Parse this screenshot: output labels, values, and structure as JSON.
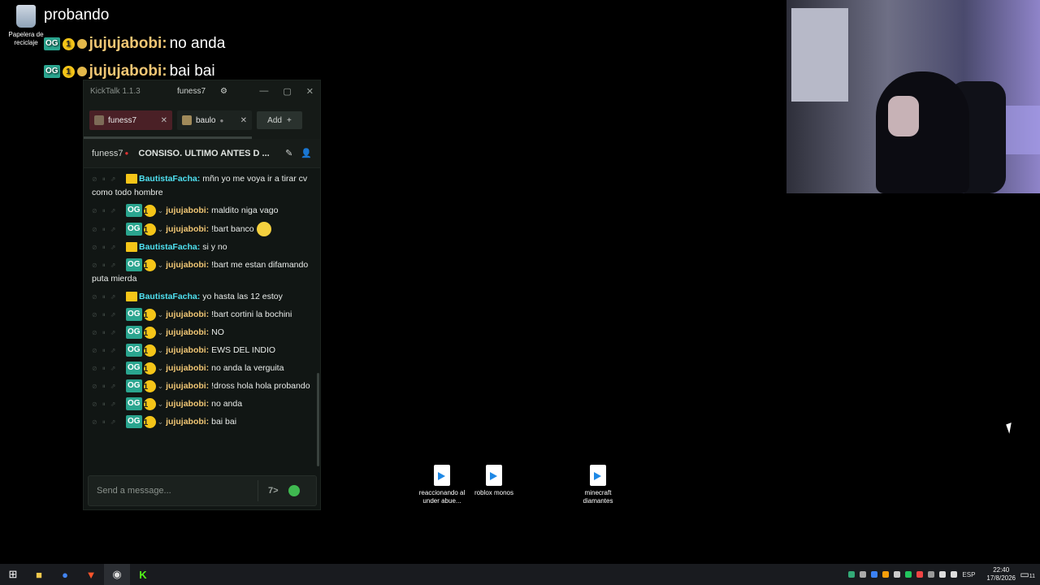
{
  "desktop": {
    "recycle_bin": "Papelera de reciclaje",
    "icons": [
      {
        "label": "reaccionando al under abue..."
      },
      {
        "label": "roblox monos"
      },
      {
        "label": "minecraft diamantes"
      }
    ]
  },
  "overlay": {
    "lines": [
      {
        "user": "",
        "text": "probando"
      },
      {
        "user": "jujujabobi:",
        "text": "no anda"
      },
      {
        "user": "jujujabobi:",
        "text": "bai bai"
      }
    ],
    "badge_og": "OG",
    "badge_sub": "1"
  },
  "window": {
    "app_title": "KickTalk 1.1.3",
    "center_user": "funess7",
    "settings_icon": "gear-icon",
    "controls": [
      "—",
      "▢",
      "✕"
    ]
  },
  "tabs": [
    {
      "label": "funess7",
      "active": true
    },
    {
      "label": "baulo",
      "active": false
    }
  ],
  "add_label": "Add",
  "channel": {
    "name": "funess7",
    "title": "CONSISO. ULTIMO ANTES D ..."
  },
  "messages": [
    {
      "user": "BautistaFacha:",
      "text": "mñn yo me voya ir a tirar cv como todo hombre",
      "color": "cyan",
      "badges": "crown"
    },
    {
      "user": "jujujabobi:",
      "text": "maldito niga vago",
      "color": "yellow",
      "badges": "og"
    },
    {
      "user": "jujujabobi:",
      "text": "!bart banco",
      "color": "yellow",
      "badges": "og",
      "emote": true
    },
    {
      "user": "BautistaFacha:",
      "text": "si y no",
      "color": "cyan",
      "badges": "crown"
    },
    {
      "user": "jujujabobi:",
      "text": "!bart me estan difamando puta mierda",
      "color": "yellow",
      "badges": "og"
    },
    {
      "user": "BautistaFacha:",
      "text": "yo hasta las 12 estoy",
      "color": "cyan",
      "badges": "crown"
    },
    {
      "user": "jujujabobi:",
      "text": "!bart cortini la bochini",
      "color": "yellow",
      "badges": "og"
    },
    {
      "user": "jujujabobi:",
      "text": "NO",
      "color": "yellow",
      "badges": "og"
    },
    {
      "user": "jujujabobi:",
      "text": "EWS DEL INDIO",
      "color": "yellow",
      "badges": "og"
    },
    {
      "user": "jujujabobi:",
      "text": "no anda la verguita",
      "color": "yellow",
      "badges": "og"
    },
    {
      "user": "jujujabobi:",
      "text": "!dross hola hola probando",
      "color": "yellow",
      "badges": "og"
    },
    {
      "user": "jujujabobi:",
      "text": "no anda",
      "color": "yellow",
      "badges": "og"
    },
    {
      "user": "jujujabobi:",
      "text": "bai bai",
      "color": "yellow",
      "badges": "og"
    }
  ],
  "input": {
    "placeholder": "Send a message..."
  },
  "taskbar": {
    "lang": "ESP",
    "time": "22:40",
    "date": "17/8/2026",
    "notif_count": "11"
  },
  "colors": {
    "accent_green": "#3fb950",
    "user_yellow": "#f0c674",
    "user_cyan": "#4fe0f0"
  }
}
